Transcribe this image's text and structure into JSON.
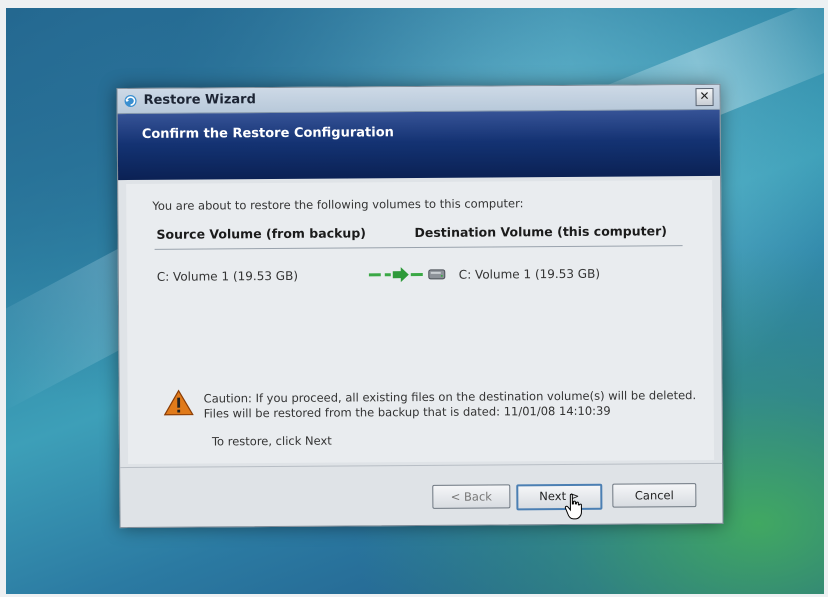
{
  "window": {
    "title": "Restore Wizard",
    "close_label": "✕"
  },
  "banner": {
    "title": "Confirm the Restore Configuration"
  },
  "content": {
    "intro": "You are about to restore the following volumes to this computer:",
    "columns": {
      "source": "Source Volume (from backup)",
      "destination": "Destination Volume (this computer)"
    },
    "rows": [
      {
        "source": "C: Volume 1 (19.53 GB)",
        "destination": "C: Volume 1 (19.53 GB)"
      }
    ],
    "caution_line1": "Caution: If you proceed, all existing files on the destination volume(s) will be deleted.",
    "caution_line2": "Files will be restored from the backup that is dated: 11/01/08 14:10:39",
    "restore_hint": "To restore, click Next"
  },
  "buttons": {
    "back": "< Back",
    "next": "Next >",
    "cancel": "Cancel"
  },
  "colors": {
    "banner": "#12306e",
    "arrow": "#3aa845",
    "warning": "#e07a1a"
  },
  "icons": [
    "restore-wizard-icon",
    "close-icon",
    "arrow-icon",
    "hard-drive-icon",
    "warning-icon",
    "mouse-cursor-icon"
  ]
}
